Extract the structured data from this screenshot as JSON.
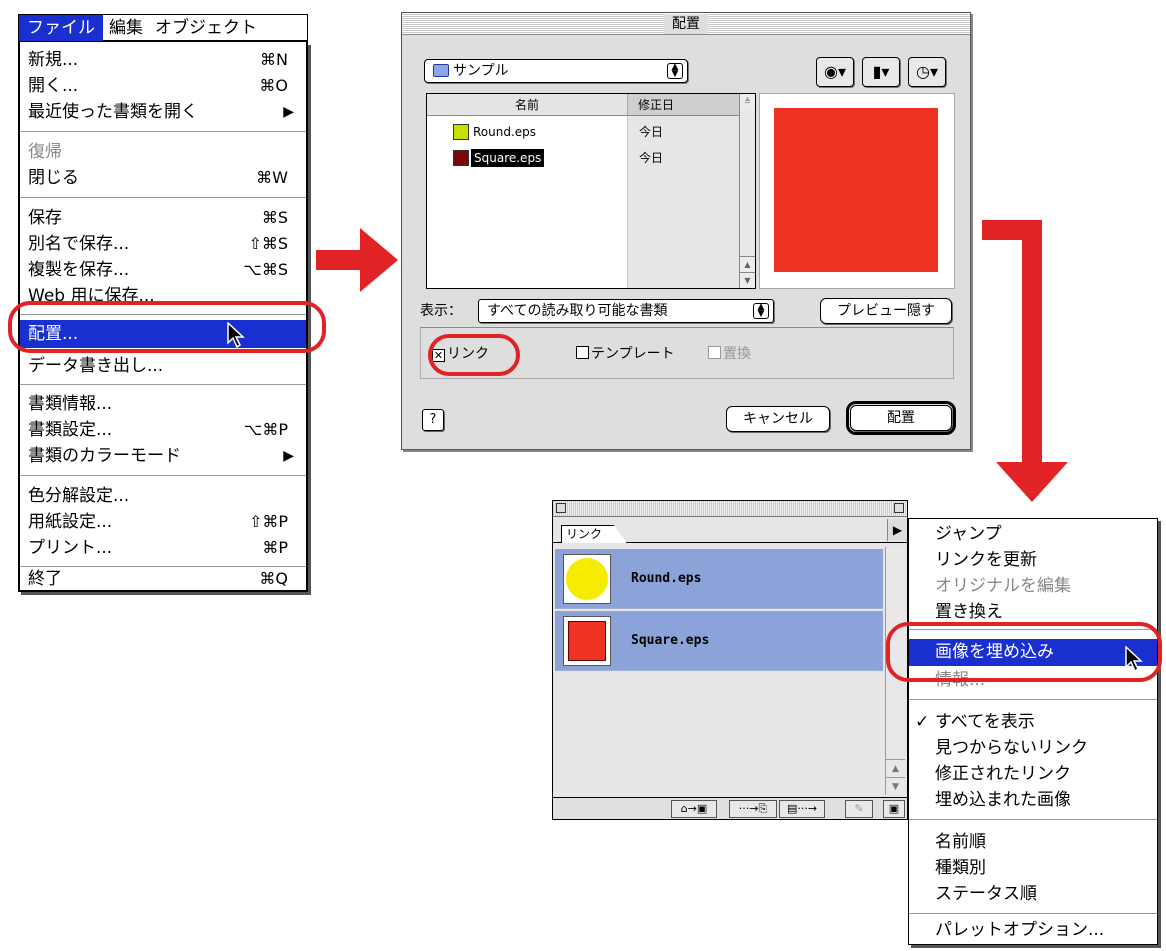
{
  "file_menu": {
    "menubar": [
      "ファイル",
      "編集",
      "オブジェクト"
    ],
    "items": [
      {
        "label": "新規...",
        "shortcut": "⌘N"
      },
      {
        "label": "開く...",
        "shortcut": "⌘O"
      },
      {
        "label": "最近使った書類を開く",
        "submenu": "▶"
      },
      {
        "label": "復帰",
        "disabled": true
      },
      {
        "label": "閉じる",
        "shortcut": "⌘W"
      },
      {
        "label": "保存",
        "shortcut": "⌘S"
      },
      {
        "label": "別名で保存...",
        "shortcut": "⇧⌘S"
      },
      {
        "label": "複製を保存...",
        "shortcut": "⌥⌘S"
      },
      {
        "label": "Web 用に保存..."
      },
      {
        "label": "配置...",
        "highlighted": true
      },
      {
        "label": "データ書き出し..."
      },
      {
        "label": "書類情報..."
      },
      {
        "label": "書類設定...",
        "shortcut": "⌥⌘P"
      },
      {
        "label": "書類のカラーモード",
        "submenu": "▶"
      },
      {
        "label": "色分解設定..."
      },
      {
        "label": "用紙設定...",
        "shortcut": "⇧⌘P"
      },
      {
        "label": "プリント...",
        "shortcut": "⌘P"
      },
      {
        "label": "終了",
        "shortcut": "⌘Q"
      }
    ]
  },
  "place_dialog": {
    "title": "配置",
    "folder": "サンプル",
    "columns": {
      "name": "名前",
      "date": "修正日"
    },
    "files": [
      {
        "name": "Round.eps",
        "date": "今日",
        "color": "#c8e000"
      },
      {
        "name": "Square.eps",
        "date": "今日",
        "color": "#7a0a0a",
        "selected": true
      }
    ],
    "preview_color": "#ee3322",
    "show_label": "表示：",
    "show_value": "すべての読み取り可能な書類",
    "preview_toggle": "プレビュー隠す",
    "option_link": "リンク",
    "option_template": "テンプレート",
    "option_replace": "置換",
    "cancel": "キャンセル",
    "place": "配置",
    "help": "?"
  },
  "links_palette": {
    "tab": "リンク",
    "links": [
      {
        "name": "Round.eps",
        "shape": "circle",
        "color": "#f6ec00"
      },
      {
        "name": "Square.eps",
        "shape": "square",
        "color": "#ee3322"
      }
    ],
    "buttons": [
      "⌂→▣",
      "···→⎘",
      "▤···→",
      "✎",
      "▣"
    ]
  },
  "palette_menu": {
    "items": [
      {
        "label": "ジャンプ"
      },
      {
        "label": "リンクを更新"
      },
      {
        "label": "オリジナルを編集",
        "disabled": true
      },
      {
        "label": "置き換え"
      },
      {
        "label": "画像を埋め込み",
        "highlighted": true
      },
      {
        "label": "情報...",
        "disabled": true
      },
      {
        "label": "すべてを表示",
        "checked": true
      },
      {
        "label": "見つからないリンク"
      },
      {
        "label": "修正されたリンク"
      },
      {
        "label": "埋め込まれた画像"
      },
      {
        "label": "名前順"
      },
      {
        "label": "種類別"
      },
      {
        "label": "ステータス順"
      },
      {
        "label": "パレットオプション..."
      }
    ]
  },
  "colors": {
    "accent_red": "#e12325",
    "highlight_blue": "#1a2fd0"
  },
  "icons": {
    "checkmark": "✓",
    "submenu_arrow": "▶",
    "up_down": "⬍",
    "help": "?"
  }
}
